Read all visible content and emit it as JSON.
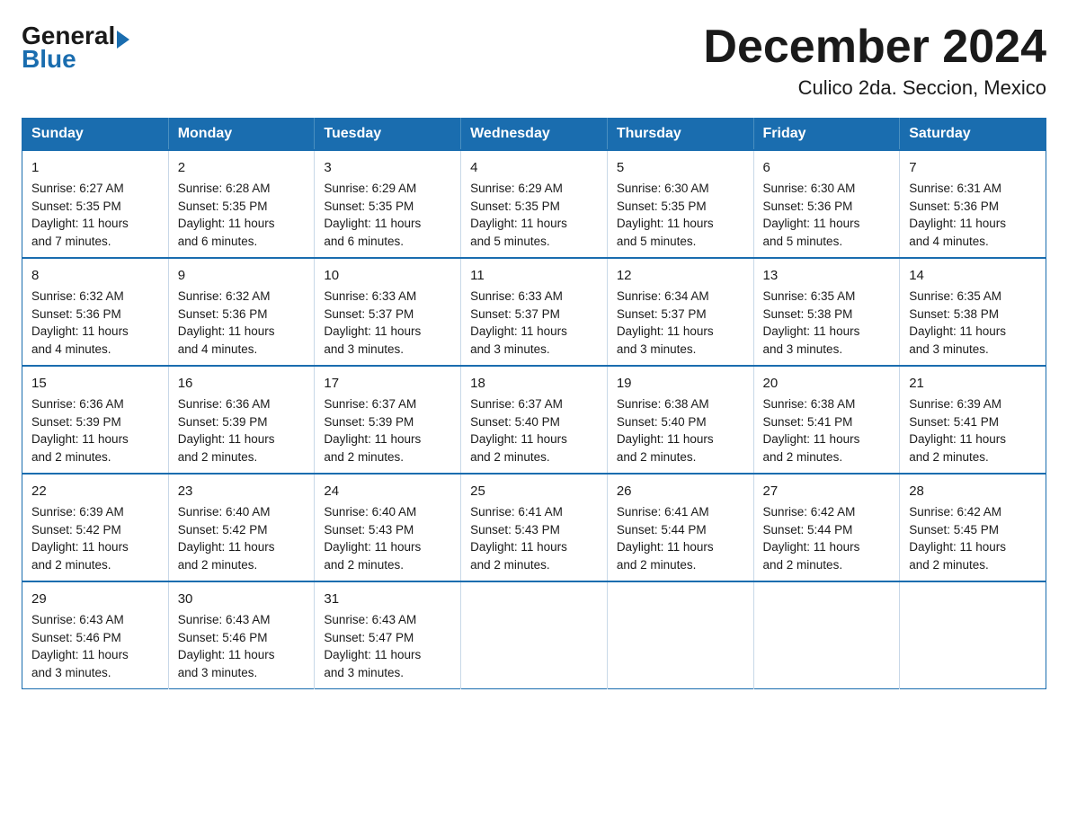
{
  "header": {
    "logo_general": "General",
    "logo_blue": "Blue",
    "month_title": "December 2024",
    "location": "Culico 2da. Seccion, Mexico"
  },
  "weekdays": [
    "Sunday",
    "Monday",
    "Tuesday",
    "Wednesday",
    "Thursday",
    "Friday",
    "Saturday"
  ],
  "weeks": [
    [
      {
        "day": "1",
        "sunrise": "6:27 AM",
        "sunset": "5:35 PM",
        "daylight": "11 hours and 7 minutes."
      },
      {
        "day": "2",
        "sunrise": "6:28 AM",
        "sunset": "5:35 PM",
        "daylight": "11 hours and 6 minutes."
      },
      {
        "day": "3",
        "sunrise": "6:29 AM",
        "sunset": "5:35 PM",
        "daylight": "11 hours and 6 minutes."
      },
      {
        "day": "4",
        "sunrise": "6:29 AM",
        "sunset": "5:35 PM",
        "daylight": "11 hours and 5 minutes."
      },
      {
        "day": "5",
        "sunrise": "6:30 AM",
        "sunset": "5:35 PM",
        "daylight": "11 hours and 5 minutes."
      },
      {
        "day": "6",
        "sunrise": "6:30 AM",
        "sunset": "5:36 PM",
        "daylight": "11 hours and 5 minutes."
      },
      {
        "day": "7",
        "sunrise": "6:31 AM",
        "sunset": "5:36 PM",
        "daylight": "11 hours and 4 minutes."
      }
    ],
    [
      {
        "day": "8",
        "sunrise": "6:32 AM",
        "sunset": "5:36 PM",
        "daylight": "11 hours and 4 minutes."
      },
      {
        "day": "9",
        "sunrise": "6:32 AM",
        "sunset": "5:36 PM",
        "daylight": "11 hours and 4 minutes."
      },
      {
        "day": "10",
        "sunrise": "6:33 AM",
        "sunset": "5:37 PM",
        "daylight": "11 hours and 3 minutes."
      },
      {
        "day": "11",
        "sunrise": "6:33 AM",
        "sunset": "5:37 PM",
        "daylight": "11 hours and 3 minutes."
      },
      {
        "day": "12",
        "sunrise": "6:34 AM",
        "sunset": "5:37 PM",
        "daylight": "11 hours and 3 minutes."
      },
      {
        "day": "13",
        "sunrise": "6:35 AM",
        "sunset": "5:38 PM",
        "daylight": "11 hours and 3 minutes."
      },
      {
        "day": "14",
        "sunrise": "6:35 AM",
        "sunset": "5:38 PM",
        "daylight": "11 hours and 3 minutes."
      }
    ],
    [
      {
        "day": "15",
        "sunrise": "6:36 AM",
        "sunset": "5:39 PM",
        "daylight": "11 hours and 2 minutes."
      },
      {
        "day": "16",
        "sunrise": "6:36 AM",
        "sunset": "5:39 PM",
        "daylight": "11 hours and 2 minutes."
      },
      {
        "day": "17",
        "sunrise": "6:37 AM",
        "sunset": "5:39 PM",
        "daylight": "11 hours and 2 minutes."
      },
      {
        "day": "18",
        "sunrise": "6:37 AM",
        "sunset": "5:40 PM",
        "daylight": "11 hours and 2 minutes."
      },
      {
        "day": "19",
        "sunrise": "6:38 AM",
        "sunset": "5:40 PM",
        "daylight": "11 hours and 2 minutes."
      },
      {
        "day": "20",
        "sunrise": "6:38 AM",
        "sunset": "5:41 PM",
        "daylight": "11 hours and 2 minutes."
      },
      {
        "day": "21",
        "sunrise": "6:39 AM",
        "sunset": "5:41 PM",
        "daylight": "11 hours and 2 minutes."
      }
    ],
    [
      {
        "day": "22",
        "sunrise": "6:39 AM",
        "sunset": "5:42 PM",
        "daylight": "11 hours and 2 minutes."
      },
      {
        "day": "23",
        "sunrise": "6:40 AM",
        "sunset": "5:42 PM",
        "daylight": "11 hours and 2 minutes."
      },
      {
        "day": "24",
        "sunrise": "6:40 AM",
        "sunset": "5:43 PM",
        "daylight": "11 hours and 2 minutes."
      },
      {
        "day": "25",
        "sunrise": "6:41 AM",
        "sunset": "5:43 PM",
        "daylight": "11 hours and 2 minutes."
      },
      {
        "day": "26",
        "sunrise": "6:41 AM",
        "sunset": "5:44 PM",
        "daylight": "11 hours and 2 minutes."
      },
      {
        "day": "27",
        "sunrise": "6:42 AM",
        "sunset": "5:44 PM",
        "daylight": "11 hours and 2 minutes."
      },
      {
        "day": "28",
        "sunrise": "6:42 AM",
        "sunset": "5:45 PM",
        "daylight": "11 hours and 2 minutes."
      }
    ],
    [
      {
        "day": "29",
        "sunrise": "6:43 AM",
        "sunset": "5:46 PM",
        "daylight": "11 hours and 3 minutes."
      },
      {
        "day": "30",
        "sunrise": "6:43 AM",
        "sunset": "5:46 PM",
        "daylight": "11 hours and 3 minutes."
      },
      {
        "day": "31",
        "sunrise": "6:43 AM",
        "sunset": "5:47 PM",
        "daylight": "11 hours and 3 minutes."
      },
      null,
      null,
      null,
      null
    ]
  ],
  "labels": {
    "sunrise": "Sunrise:",
    "sunset": "Sunset:",
    "daylight": "Daylight:"
  }
}
